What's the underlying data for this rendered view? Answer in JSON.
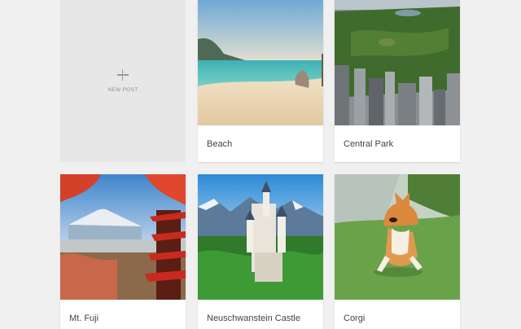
{
  "new_post": {
    "label": "NEW POST",
    "icon": "plus-icon"
  },
  "posts": [
    {
      "title": "Beach",
      "image": "beach-photo"
    },
    {
      "title": "Central Park",
      "image": "central-park-photo"
    },
    {
      "title": "Mt. Fuji",
      "image": "mt-fuji-photo"
    },
    {
      "title": "Neuschwanstein Castle",
      "image": "neuschwanstein-castle-photo"
    },
    {
      "title": "Corgi",
      "image": "corgi-photo"
    }
  ],
  "colors": {
    "background": "#f0f0f0",
    "card": "#ffffff",
    "new_post_tile": "#e7e7e7",
    "caption_text": "#444444"
  }
}
